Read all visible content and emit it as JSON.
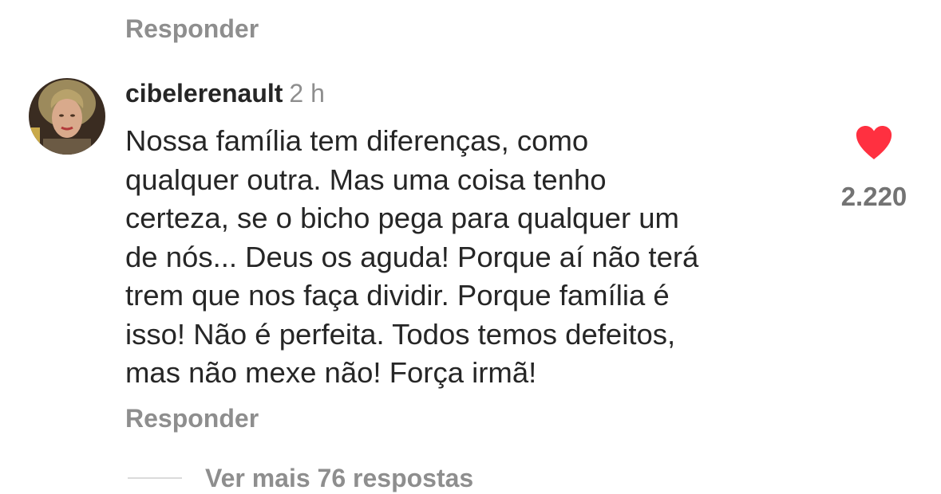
{
  "reply_top_label": "Responder",
  "comment": {
    "username": "cibelerenault",
    "time_ago": "2 h",
    "text_lines": [
      "Nossa família tem diferenças, como",
      "qualquer outra. Mas uma coisa tenho",
      "certeza, se o bicho pega para qualquer um",
      "de nós... Deus os aguda! Porque aí não terá",
      "trem que nos faça dividir. Porque família é",
      "isso! Não é perfeita. Todos temos defeitos,",
      "mas não mexe não!  Força irmã!"
    ],
    "like_icon": "heart-filled-icon",
    "like_color": "#ff3040",
    "like_count": "2.220",
    "reply_label": "Responder"
  },
  "more_replies_label": "Ver mais 76 respostas"
}
